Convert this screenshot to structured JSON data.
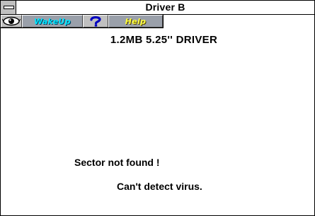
{
  "window": {
    "title": "Driver B"
  },
  "toolbar": {
    "eye_icon": "eye-icon",
    "wakeup_label": "WakeUp",
    "help_icon": "question-mark-icon",
    "help_label": "Help"
  },
  "main": {
    "drive_label": "1.2MB 5.25'' DRIVER",
    "status_line1": "Sector not found !",
    "status_line2": "Can't detect virus."
  },
  "colors": {
    "wakeup_text": "#00e5ff",
    "help_text": "#ffff40",
    "help_icon": "#0000c0"
  }
}
